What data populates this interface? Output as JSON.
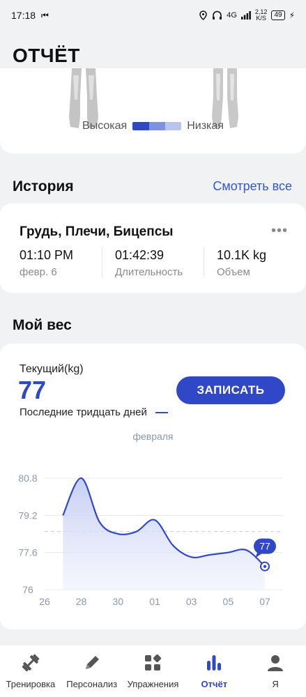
{
  "status_bar": {
    "time": "17:18",
    "network": "4G",
    "speed": "2,12",
    "speed_unit": "K/S",
    "battery": "49"
  },
  "header": {
    "title": "ОТЧЁТ"
  },
  "muscle_map": {
    "legend_high": "Высокая",
    "legend_low": "Низкая",
    "legend_colors": [
      "#3048c8",
      "#7f92e0",
      "#b9c4ef"
    ]
  },
  "history": {
    "title": "История",
    "see_all": "Смотреть все",
    "workout": {
      "title": "Грудь, Плечи, Бицепсы",
      "stats": [
        {
          "value": "01:10 PM",
          "label": "февр. 6"
        },
        {
          "value": "01:42:39",
          "label": "Длительность"
        },
        {
          "value": "10.1K kg",
          "label": "Объем"
        }
      ]
    }
  },
  "weight": {
    "title": "Мой вес",
    "current_label": "Текущий(kg)",
    "current_value": "77",
    "period": "Последние тридцать дней",
    "record_button": "ЗАПИСАТЬ",
    "month": "февраля",
    "callout": "77"
  },
  "chart_data": {
    "type": "area",
    "x_ticks": [
      "26",
      "28",
      "30",
      "01",
      "03",
      "05",
      "07"
    ],
    "y_ticks": [
      "80.8",
      "79.2",
      "77.6",
      "76"
    ],
    "ylim": [
      76,
      80.8
    ],
    "x": [
      27,
      28,
      29,
      30,
      31,
      1,
      2,
      3,
      4,
      5,
      6,
      7
    ],
    "values": [
      79.2,
      80.8,
      78.9,
      78.4,
      78.5,
      79.0,
      77.9,
      77.4,
      77.5,
      77.6,
      77.7,
      77.0
    ],
    "reference_line": 78.5,
    "color": "#3048c8"
  },
  "nav": {
    "items": [
      {
        "label": "Тренировка",
        "icon": "dumbbell-icon"
      },
      {
        "label": "Персонализ",
        "icon": "pencil-icon"
      },
      {
        "label": "Упражнения",
        "icon": "grid-icon"
      },
      {
        "label": "Отчёт",
        "icon": "bar-chart-icon"
      },
      {
        "label": "Я",
        "icon": "user-icon"
      }
    ],
    "active_index": 3
  }
}
